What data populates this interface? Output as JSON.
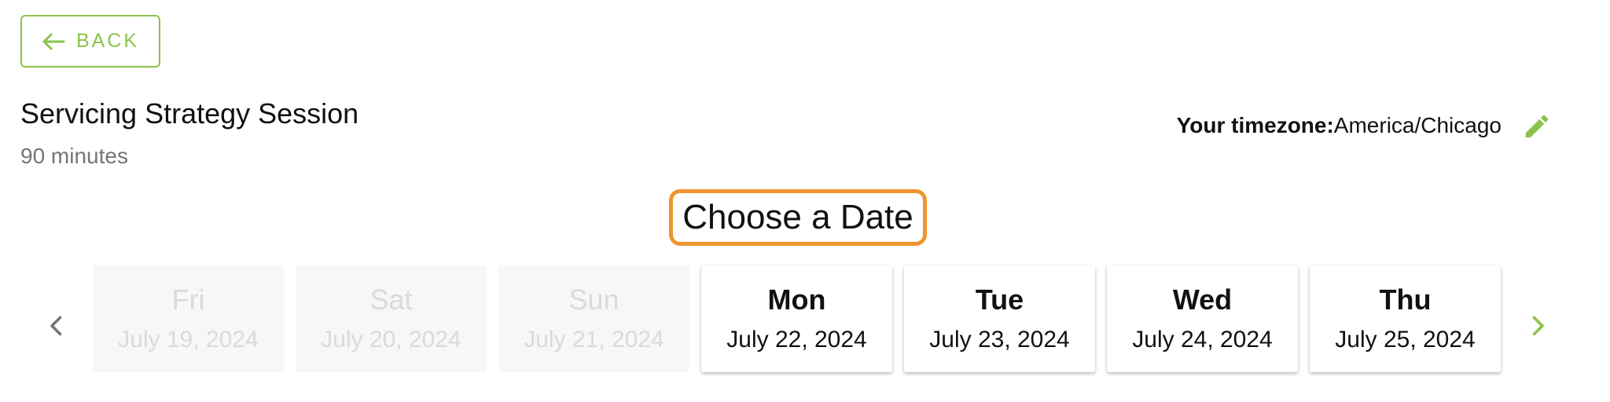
{
  "back_button": {
    "label": "BACK",
    "icon": "arrow-left-icon"
  },
  "session": {
    "title": "Servicing Strategy Session",
    "duration": "90 minutes"
  },
  "timezone": {
    "label": "Your timezone:",
    "value": "America/Chicago",
    "edit_icon": "pencil-icon"
  },
  "heading": "Choose a Date",
  "navigation": {
    "prev_icon": "chevron-left-icon",
    "next_icon": "chevron-right-icon"
  },
  "days": [
    {
      "day": "Fri",
      "date": "July 19, 2024",
      "available": false
    },
    {
      "day": "Sat",
      "date": "July 20, 2024",
      "available": false
    },
    {
      "day": "Sun",
      "date": "July 21, 2024",
      "available": false
    },
    {
      "day": "Mon",
      "date": "July 22, 2024",
      "available": true
    },
    {
      "day": "Tue",
      "date": "July 23, 2024",
      "available": true
    },
    {
      "day": "Wed",
      "date": "July 24, 2024",
      "available": true
    },
    {
      "day": "Thu",
      "date": "July 25, 2024",
      "available": true
    }
  ],
  "colors": {
    "accent_green": "#8bc34a",
    "highlight_orange": "#f0952e",
    "disabled_text": "#dadada",
    "secondary_text": "#757575"
  }
}
